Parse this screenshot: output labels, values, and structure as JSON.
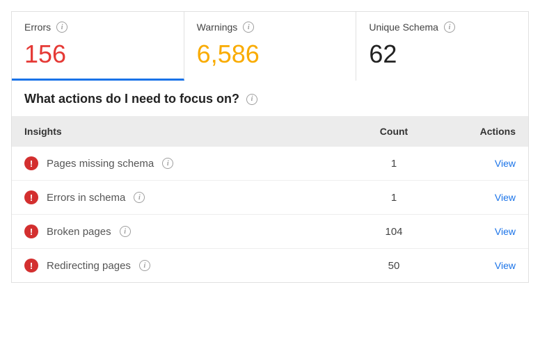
{
  "stats": {
    "errors": {
      "label": "Errors",
      "value": "156"
    },
    "warnings": {
      "label": "Warnings",
      "value": "6,586"
    },
    "unique_schema": {
      "label": "Unique Schema",
      "value": "62"
    }
  },
  "section": {
    "title": "What actions do I need to focus on?"
  },
  "table": {
    "headers": {
      "insights": "Insights",
      "count": "Count",
      "actions": "Actions"
    },
    "view_label": "View",
    "rows": [
      {
        "label": "Pages missing schema",
        "count": "1"
      },
      {
        "label": "Errors in schema",
        "count": "1"
      },
      {
        "label": "Broken pages",
        "count": "104"
      },
      {
        "label": "Redirecting pages",
        "count": "50"
      }
    ]
  }
}
